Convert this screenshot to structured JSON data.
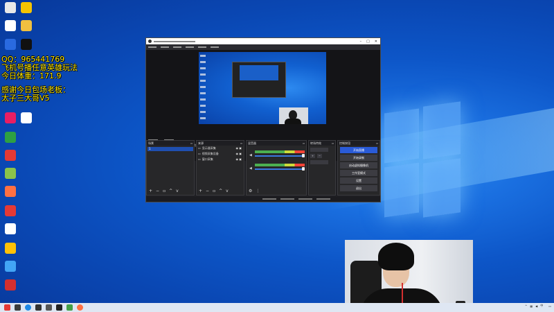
{
  "overlay": {
    "line1": "QQ：965441769",
    "line2": "飞机号播任意英雄玩法",
    "line3": "今日体重：171.9",
    "line4": "感谢今日包场老板：",
    "line5": "太子三大哥V5"
  },
  "desktop_icons": [
    {
      "name": "desktop-icon-1",
      "color": "#e8e8e8"
    },
    {
      "name": "desktop-icon-2",
      "color": "#f5c400"
    },
    {
      "name": "desktop-icon-3",
      "color": "#2a6ae0"
    },
    {
      "name": "desktop-icon-4",
      "color": "#f0c040"
    },
    {
      "name": "desktop-icon-5",
      "color": "#1a1a1a"
    },
    {
      "name": "desktop-icon-6",
      "color": "#111111"
    },
    {
      "name": "desktop-icon-7",
      "color": "#e91e63"
    },
    {
      "name": "desktop-icon-8",
      "color": "#ffffff"
    },
    {
      "name": "desktop-icon-9",
      "color": "#2ea043"
    },
    {
      "name": "desktop-icon-10",
      "color": "#e53935"
    },
    {
      "name": "desktop-icon-11",
      "color": "#8bc34a"
    },
    {
      "name": "desktop-icon-12",
      "color": "#ff7043"
    },
    {
      "name": "desktop-icon-13",
      "color": "#e53935"
    },
    {
      "name": "desktop-icon-14",
      "color": "#ffffff"
    },
    {
      "name": "desktop-icon-15",
      "color": "#ffc107"
    },
    {
      "name": "desktop-icon-16",
      "color": "#42a5f5"
    },
    {
      "name": "desktop-icon-17",
      "color": "#d32f2f"
    }
  ],
  "obs": {
    "scenes_title": "场景",
    "scene_item": "1",
    "sources_title": "来源",
    "sources": [
      {
        "label": "显示器采集"
      },
      {
        "label": "视频采集设备"
      },
      {
        "label": "窗口采集"
      }
    ],
    "mixer_title": "混音器",
    "transitions_title": "转场特效",
    "controls_title": "控制按钮",
    "controls": [
      "开始直播",
      "开始录制",
      "启动虚拟摄像机",
      "工作室模式",
      "设置",
      "退出"
    ],
    "tabs": [
      "滤镜",
      "属性"
    ]
  },
  "taskbar": {
    "time": "",
    "date": ""
  },
  "colors": {
    "accent": "#2a5bd7",
    "overlay_text": "#ffe600"
  }
}
